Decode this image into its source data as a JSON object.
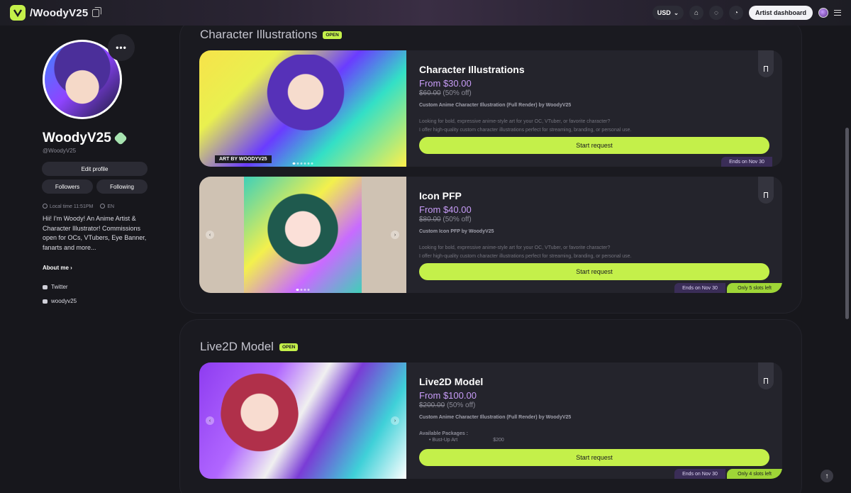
{
  "header": {
    "handle": "/WoodyV25",
    "currency": "USD",
    "artist_dashboard": "Artist dashboard"
  },
  "profile": {
    "name": "WoodyV25",
    "at": "@WoodyV25",
    "edit_profile": "Edit profile",
    "followers": "Followers",
    "following": "Following",
    "local_time": "Local time 11:51PM",
    "language": "EN",
    "bio": "Hii! I'm Woody! An Anime Artist & Character Illustrator! Commissions open for OCs, VTubers, Eye Banner, fanarts and more...",
    "about_me": "About me",
    "twitter": "Twitter",
    "discord": "woodyv25"
  },
  "sections": [
    {
      "title": "Character Illustrations",
      "badge": "OPEN"
    },
    {
      "title": "Live2D Model",
      "badge": "OPEN"
    }
  ],
  "cards": [
    {
      "title": "Character Illustrations",
      "price": "From $30.00",
      "original": "$60.00",
      "discount": "(50% off)",
      "subtitle": "Custom Anime Character Illustration (Full Render) by WoodyV25",
      "desc1": "Looking for bold, expressive anime-style art for your OC, VTuber, or favorite character?",
      "desc2": "I offer high-quality custom character illustrations perfect for streaming, branding, or personal use.",
      "button": "Start request",
      "ends": "Ends on Nov 30",
      "image_caption": "ART BY WOODYV25"
    },
    {
      "title": "Icon PFP",
      "price": "From $40.00",
      "original": "$80.00",
      "discount": "(50% off)",
      "subtitle": "Custom Icon PFP by WoodyV25",
      "desc1": "Looking for bold, expressive anime-style art for your OC, VTuber, or favorite character?",
      "desc2": "I offer high-quality custom character illustrations perfect for streaming, branding, or personal use.",
      "button": "Start request",
      "ends": "Ends on Nov 30",
      "slots": "Only 5 slots left"
    },
    {
      "title": "Live2D Model",
      "price": "From $100.00",
      "original": "$200.00",
      "discount": "(50% off)",
      "subtitle": "Custom Anime Character Illustration (Full Render) by WoodyV25",
      "packages_label": "Available Packages :",
      "package_name": "Bust-Up Art",
      "package_price": "$200",
      "button": "Start request",
      "ends": "Ends on Nov 30",
      "slots": "Only 4 slots left"
    }
  ],
  "colors": {
    "accent": "#c4f04a",
    "price": "#c89cf8",
    "background": "#17171c"
  }
}
